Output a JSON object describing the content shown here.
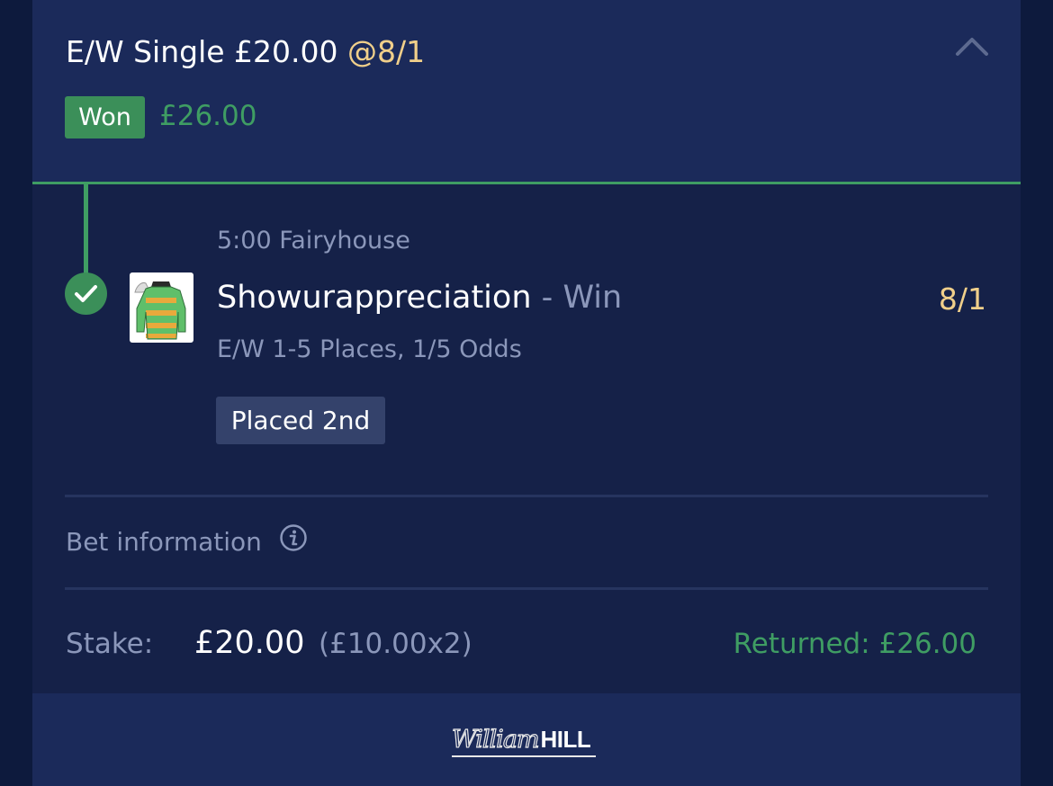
{
  "bet": {
    "title": "E/W Single £20.00",
    "odds": "@8/1",
    "status_badge": "Won",
    "won_amount": "£26.00",
    "collapse_icon": "chevron-up-icon"
  },
  "selection": {
    "race": "5:00 Fairyhouse",
    "horse": "Showurappreciation",
    "dash": "-",
    "market": "Win",
    "odds": "8/1",
    "terms": "E/W 1-5 Places, 1/5 Odds",
    "result_badge": "Placed 2nd",
    "status_icon": "check-circle-icon",
    "silk_icon": "jockey-silk-icon",
    "silk_colors": {
      "stripe_green": "#5fbf6a",
      "stripe_orange": "#e8a93c",
      "cap": "#2a2a2a"
    }
  },
  "bet_information": {
    "label": "Bet information",
    "icon": "info-icon"
  },
  "summary": {
    "stake_label": "Stake:",
    "stake_value": "£20.00",
    "stake_detail": "(£10.00x2)",
    "returned": "Returned: £26.00"
  },
  "footer": {
    "logo_script": "William",
    "logo_bold": "HILL"
  },
  "colors": {
    "background": "#0d1a3d",
    "card": "#152148",
    "header": "#1b2a5a",
    "accent_green": "#3f9d63",
    "odds_gold": "#f0cf8a",
    "muted_text": "#8b97ba"
  }
}
